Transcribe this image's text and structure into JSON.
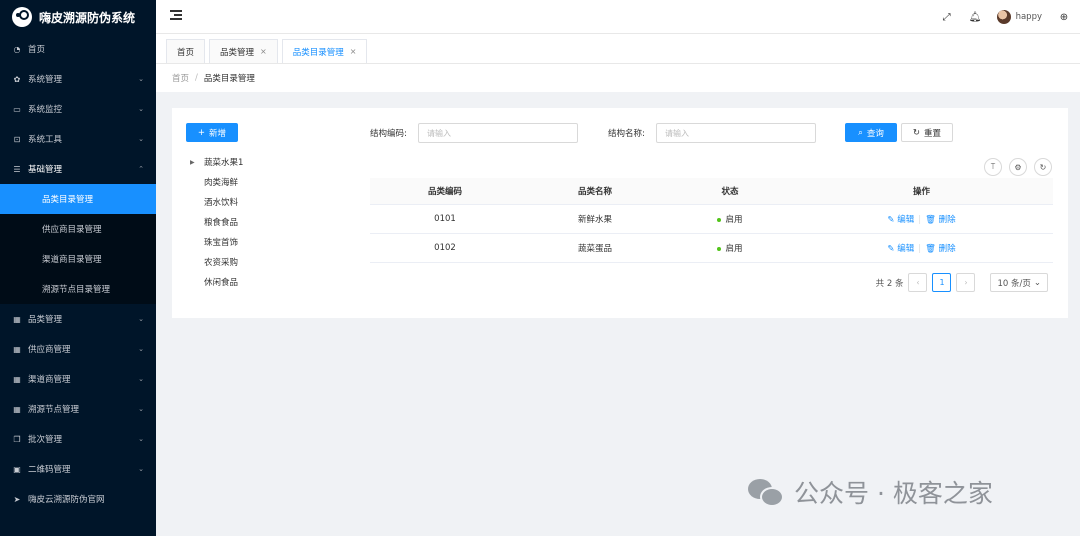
{
  "app": {
    "title": "嗨皮溯源防伪系统"
  },
  "sidebar": {
    "items": [
      {
        "label": "首页",
        "icon": "dashboard-icon",
        "glyph": "◔",
        "has_arrow": false
      },
      {
        "label": "系统管理",
        "icon": "gear-icon",
        "glyph": "✿",
        "has_arrow": true
      },
      {
        "label": "系统监控",
        "icon": "monitor-icon",
        "glyph": "▭",
        "has_arrow": true
      },
      {
        "label": "系统工具",
        "icon": "toolbox-icon",
        "glyph": "⊡",
        "has_arrow": true
      },
      {
        "label": "基础管理",
        "icon": "sliders-icon",
        "glyph": "☰",
        "has_arrow": true,
        "open": true
      },
      {
        "label": "品类管理",
        "icon": "table-icon",
        "glyph": "▦",
        "has_arrow": true
      },
      {
        "label": "供应商管理",
        "icon": "table-icon",
        "glyph": "▦",
        "has_arrow": true
      },
      {
        "label": "渠道商管理",
        "icon": "table-icon",
        "glyph": "▦",
        "has_arrow": true
      },
      {
        "label": "溯源节点管理",
        "icon": "table-icon",
        "glyph": "▦",
        "has_arrow": true
      },
      {
        "label": "批次管理",
        "icon": "copy-icon",
        "glyph": "❐",
        "has_arrow": true
      },
      {
        "label": "二维码管理",
        "icon": "qrcode-icon",
        "glyph": "▣",
        "has_arrow": true
      },
      {
        "label": "嗨皮云溯源防伪官网",
        "icon": "send-icon",
        "glyph": "➤",
        "has_arrow": false
      }
    ],
    "submenu": [
      {
        "label": "品类目录管理",
        "active": true
      },
      {
        "label": "供应商目录管理",
        "active": false
      },
      {
        "label": "渠道商目录管理",
        "active": false
      },
      {
        "label": "溯源节点目录管理",
        "active": false
      }
    ]
  },
  "header": {
    "username": "happy",
    "icons": {
      "fullscreen": "fullscreen-icon",
      "bell": "bell-icon",
      "globe": "globe-icon"
    }
  },
  "tabs": [
    {
      "label": "首页",
      "closable": false,
      "active": false
    },
    {
      "label": "品类管理",
      "closable": true,
      "active": false
    },
    {
      "label": "品类目录管理",
      "closable": true,
      "active": true
    }
  ],
  "breadcrumb": {
    "home": "首页",
    "separator": "/",
    "current": "品类目录管理"
  },
  "toolbar": {
    "add_label": "新增"
  },
  "tree": {
    "root": "蔬菜水果1",
    "children": [
      "肉类海鲜",
      "酒水饮料",
      "粮食食品",
      "珠宝首饰",
      "农资采购",
      "休闲食品"
    ]
  },
  "search": {
    "code_label": "结构编码:",
    "code_placeholder": "请输入",
    "name_label": "结构名称:",
    "name_placeholder": "请输入",
    "query_label": "查询",
    "reset_label": "重置"
  },
  "table": {
    "headers": [
      "品类编码",
      "品类名称",
      "状态",
      "操作"
    ],
    "rows": [
      {
        "code": "0101",
        "name": "新鲜水果",
        "status": "启用"
      },
      {
        "code": "0102",
        "name": "蔬菜蛋品",
        "status": "启用"
      }
    ],
    "edit_label": "编辑",
    "delete_label": "删除"
  },
  "pagination": {
    "total": "共 2 条",
    "current": "1",
    "page_size": "10 条/页"
  },
  "watermark": {
    "text": "公众号 · 极客之家"
  },
  "colors": {
    "primary": "#1890ff",
    "sidebar_bg": "#001529",
    "status_green": "#52c41a"
  }
}
